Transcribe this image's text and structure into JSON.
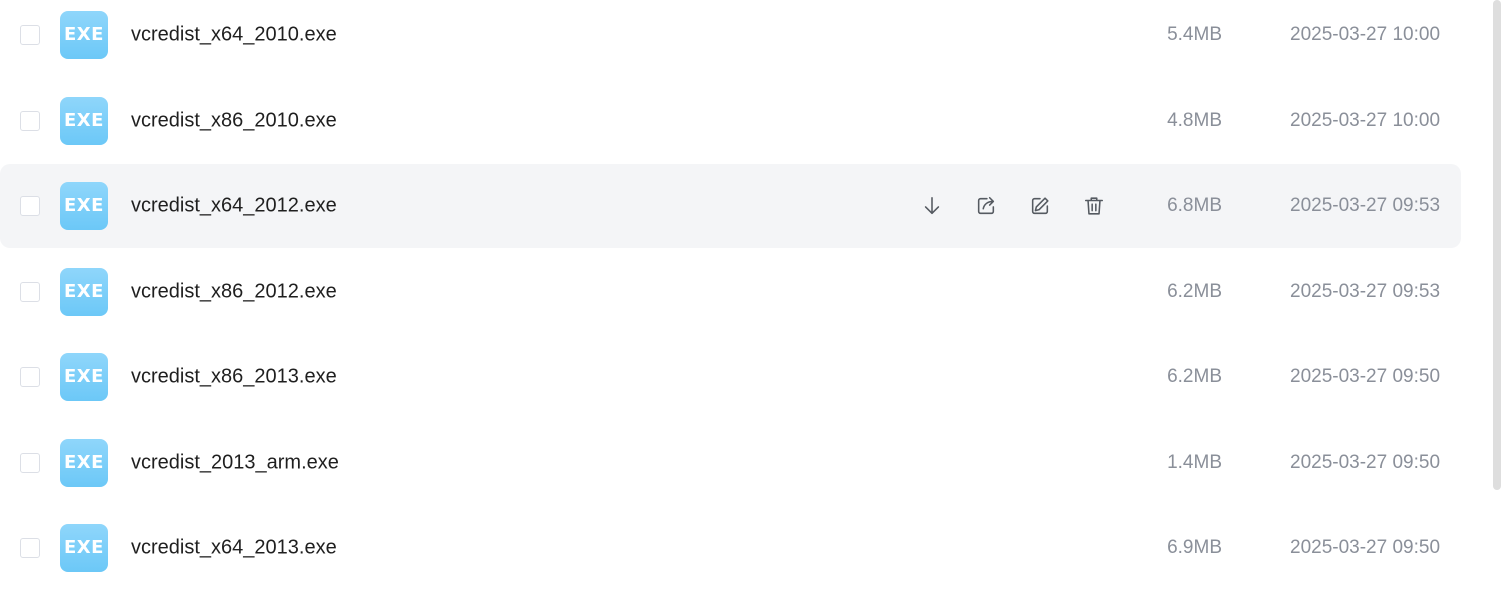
{
  "files": [
    {
      "icon_label": "EXE",
      "icon": "exe-file-icon",
      "name": "vcredist_x64_2010.exe",
      "size": "5.4MB",
      "date": "2025-03-27 10:00"
    },
    {
      "icon_label": "EXE",
      "icon": "exe-file-icon",
      "name": "vcredist_x86_2010.exe",
      "size": "4.8MB",
      "date": "2025-03-27 10:00"
    },
    {
      "icon_label": "EXE",
      "icon": "exe-file-icon",
      "name": "vcredist_x64_2012.exe",
      "size": "6.8MB",
      "date": "2025-03-27 09:53"
    },
    {
      "icon_label": "EXE",
      "icon": "exe-file-icon",
      "name": "vcredist_x86_2012.exe",
      "size": "6.2MB",
      "date": "2025-03-27 09:53"
    },
    {
      "icon_label": "EXE",
      "icon": "exe-file-icon",
      "name": "vcredist_x86_2013.exe",
      "size": "6.2MB",
      "date": "2025-03-27 09:50"
    },
    {
      "icon_label": "EXE",
      "icon": "exe-file-icon",
      "name": "vcredist_2013_arm.exe",
      "size": "1.4MB",
      "date": "2025-03-27 09:50"
    },
    {
      "icon_label": "EXE",
      "icon": "exe-file-icon",
      "name": "vcredist_x64_2013.exe",
      "size": "6.9MB",
      "date": "2025-03-27 09:50"
    }
  ],
  "hovered_row_index": 2,
  "row_actions": [
    "download-icon",
    "share-icon",
    "edit-icon",
    "delete-icon"
  ],
  "colors": {
    "icon_gradient_top": "#8fd6fb",
    "icon_gradient_bottom": "#6cc8f7",
    "hover_background": "#f4f5f7",
    "meta_text": "#8a8f99",
    "name_text": "#1f1f1f"
  }
}
